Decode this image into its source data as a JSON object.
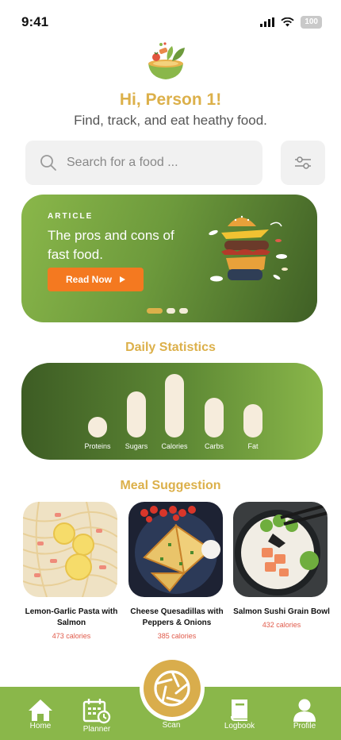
{
  "status_bar": {
    "time": "9:41",
    "battery": "100"
  },
  "header": {
    "greeting": "Hi, Person 1!",
    "tagline": "Find, track, and eat heathy food."
  },
  "search": {
    "placeholder": "Search for a food ..."
  },
  "article": {
    "tag": "ARTICLE",
    "title": "The pros and cons of fast food.",
    "button_label": "Read Now",
    "page_count": 3,
    "active_page": 1
  },
  "daily_statistics": {
    "title": "Daily Statistics",
    "items": [
      {
        "label": "Proteins",
        "level": 0.32
      },
      {
        "label": "Sugars",
        "level": 0.73
      },
      {
        "label": "Calories",
        "level": 1.0
      },
      {
        "label": "Carbs",
        "level": 0.62
      },
      {
        "label": "Fat",
        "level": 0.52
      }
    ]
  },
  "meal_suggestion": {
    "title": "Meal Suggestion",
    "meals": [
      {
        "name": "Lemon-Garlic Pasta with Salmon",
        "calories": "473 calories"
      },
      {
        "name": "Cheese Quesadillas with Peppers & Onions",
        "calories": "385 calories"
      },
      {
        "name": "Salmon Sushi Grain Bowl",
        "calories": "432 calories"
      }
    ]
  },
  "bottom_nav": {
    "home": "Home",
    "planner": "Planner",
    "scan": "Scan",
    "logbook": "Logbook",
    "profile": "Profile"
  },
  "colors": {
    "brand_green": "#8ab74a",
    "dark_green": "#3f5f25",
    "gold": "#dcb04a",
    "orange": "#f47920",
    "calorie_red": "#e05a4a"
  }
}
